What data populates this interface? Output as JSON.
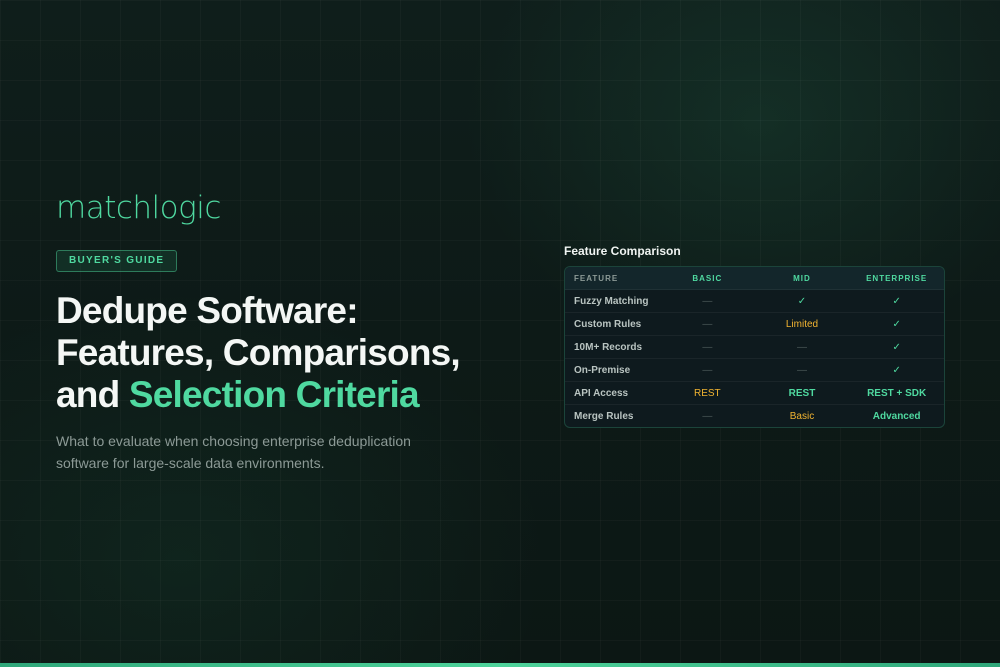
{
  "brand": {
    "logo": "matchlogic"
  },
  "hero": {
    "badge": "BUYER'S GUIDE",
    "headline_line1": "Dedupe Software:",
    "headline_line2": "Features, Comparisons,",
    "headline_line3_plain": "and ",
    "headline_line3_accent": "Selection Criteria",
    "subtitle_line1": "What to evaluate when choosing enterprise deduplication",
    "subtitle_line2": "software for large-scale data environments."
  },
  "comparison": {
    "title": "Feature Comparison",
    "columns": [
      "FEATURE",
      "BASIC",
      "MID",
      "ENTERPRISE"
    ],
    "rows": [
      {
        "feature": "Fuzzy Matching",
        "cells": [
          {
            "text": "—",
            "kind": "dash"
          },
          {
            "text": "✓",
            "kind": "check"
          },
          {
            "text": "✓",
            "kind": "check"
          }
        ]
      },
      {
        "feature": "Custom Rules",
        "cells": [
          {
            "text": "—",
            "kind": "dash"
          },
          {
            "text": "Limited",
            "kind": "amber"
          },
          {
            "text": "✓",
            "kind": "check"
          }
        ]
      },
      {
        "feature": "10M+ Records",
        "cells": [
          {
            "text": "—",
            "kind": "dash"
          },
          {
            "text": "—",
            "kind": "dash"
          },
          {
            "text": "✓",
            "kind": "check"
          }
        ]
      },
      {
        "feature": "On-Premise",
        "cells": [
          {
            "text": "—",
            "kind": "dash"
          },
          {
            "text": "—",
            "kind": "dash"
          },
          {
            "text": "✓",
            "kind": "check"
          }
        ]
      },
      {
        "feature": "API Access",
        "cells": [
          {
            "text": "REST",
            "kind": "amber"
          },
          {
            "text": "REST",
            "kind": "green"
          },
          {
            "text": "REST + SDK",
            "kind": "green"
          }
        ]
      },
      {
        "feature": "Merge Rules",
        "cells": [
          {
            "text": "—",
            "kind": "dash"
          },
          {
            "text": "Basic",
            "kind": "amber"
          },
          {
            "text": "Advanced",
            "kind": "green"
          }
        ]
      }
    ]
  },
  "colors": {
    "accent": "#4fd9a0",
    "warning": "#f2b431",
    "background": "#0d1a17",
    "muted_text": "#8c9a96"
  }
}
